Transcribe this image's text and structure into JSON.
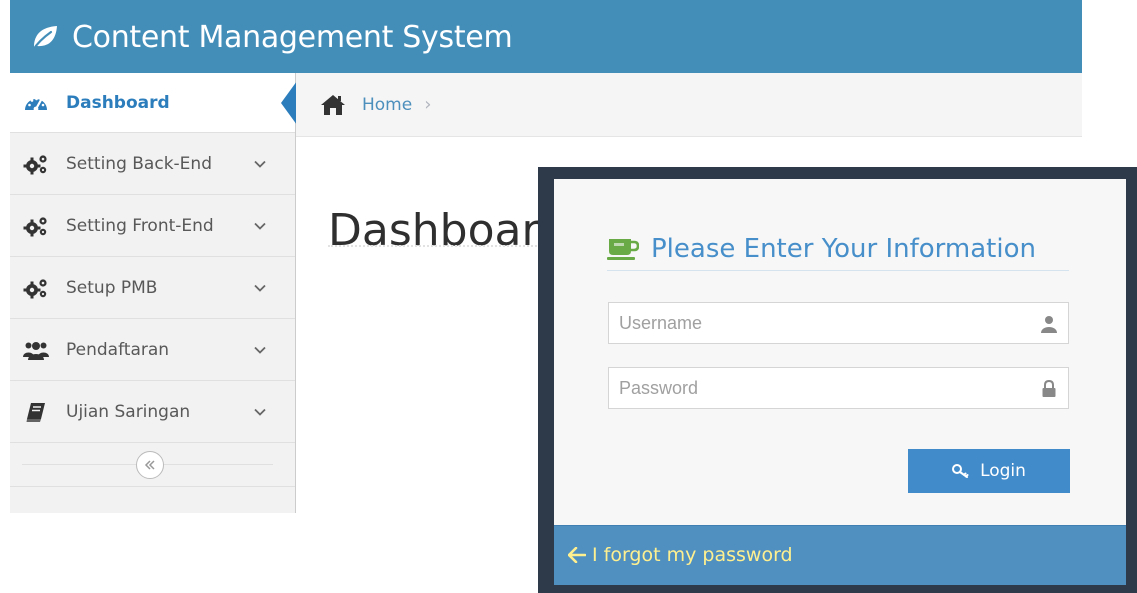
{
  "app": {
    "title": "Content Management System",
    "accent_color": "#438eb9",
    "logo_icon": "leaf-icon"
  },
  "sidebar": {
    "items": [
      {
        "label": "Dashboard",
        "icon": "tachometer-icon",
        "active": true
      },
      {
        "label": "Setting Back-End",
        "icon": "cogs-icon",
        "active": false
      },
      {
        "label": "Setting Front-End",
        "icon": "cogs-icon",
        "active": false
      },
      {
        "label": "Setup PMB",
        "icon": "cogs-icon",
        "active": false
      },
      {
        "label": "Pendaftaran",
        "icon": "users-icon",
        "active": false
      },
      {
        "label": "Ujian Saringan",
        "icon": "book-icon",
        "active": false
      }
    ],
    "collapse_icon": "double-chevron-left-icon"
  },
  "breadcrumb": {
    "home_label": "Home",
    "home_icon": "home-icon"
  },
  "main": {
    "page_title": "Dashboard"
  },
  "login": {
    "header": "Please Enter Your Information",
    "header_icon": "coffee-icon",
    "username_placeholder": "Username",
    "password_placeholder": "Password",
    "username_icon": "user-icon",
    "password_icon": "lock-icon",
    "login_label": "Login",
    "login_icon": "key-icon",
    "forgot_label": "I forgot my password",
    "forgot_icon": "arrow-left-icon",
    "forgot_color": "#fff08f"
  }
}
